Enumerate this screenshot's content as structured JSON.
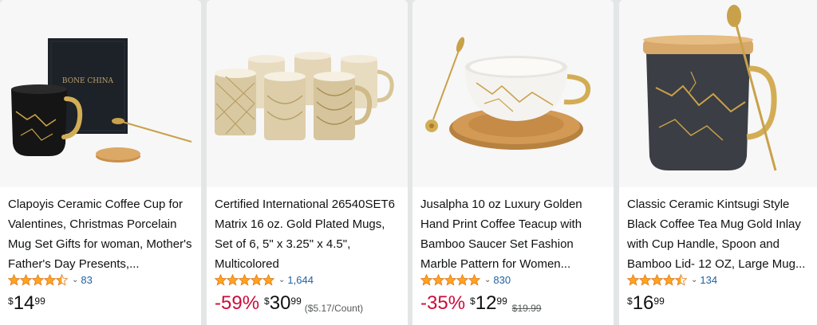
{
  "products": [
    {
      "image_alt": "Black marble mug with gold handle, bamboo lid, spoon and BONE CHINA gift box",
      "box_text": "BONE CHINA",
      "title": "Clapoyis Ceramic Coffee Cup for Valentines, Christmas Porcelain Mug Set Gifts for woman, Mother's Father's Day Presents,...",
      "rating": 4.5,
      "review_count": "83",
      "price_symbol": "$",
      "price_whole": "14",
      "price_fraction": "99"
    },
    {
      "image_alt": "Set of six gold plated patterned mugs",
      "title": "Certified International 26540SET6 Matrix 16 oz. Gold Plated Mugs, Set of 6, 5\" x 3.25\" x 4.5\", Multicolored",
      "rating": 5,
      "review_count": "1,644",
      "discount": "-59%",
      "price_symbol": "$",
      "price_whole": "30",
      "price_fraction": "99",
      "unit_price": "($5.17/Count)"
    },
    {
      "image_alt": "White marble teacup with gold handle on bamboo saucer with gold spoon",
      "title": "Jusalpha 10 oz Luxury Golden Hand Print Coffee Teacup with Bamboo Saucer Set Fashion Marble Pattern for Women...",
      "rating": 5,
      "review_count": "830",
      "discount": "-35%",
      "price_symbol": "$",
      "price_whole": "12",
      "price_fraction": "99",
      "list_price": "$19.99"
    },
    {
      "image_alt": "Black kintsugi style mug with gold veins, gold handle, bamboo lid and gold spoon",
      "title": "Classic Ceramic Kintsugi Style Black Coffee Tea Mug Gold Inlay with Cup Handle, Spoon and Bamboo Lid- 12 OZ, Large Mug...",
      "rating": 4.5,
      "review_count": "134",
      "price_symbol": "$",
      "price_whole": "16",
      "price_fraction": "99"
    }
  ],
  "colors": {
    "star": "#ffa41c",
    "link": "#2162a1",
    "discount": "#cc0c39",
    "gold": "#c9a14a"
  },
  "icons": {
    "star": "star-icon",
    "chevron": "chevron-down-icon"
  }
}
